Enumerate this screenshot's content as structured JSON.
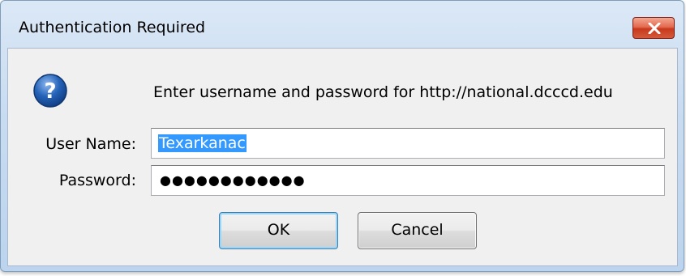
{
  "window": {
    "title": "Authentication Required",
    "close_icon": "close-icon"
  },
  "dialog": {
    "icon": "question-icon",
    "message": "Enter username and password for http://national.dcccd.edu",
    "username_label": "User Name:",
    "username_value": "Texarkanac",
    "password_label": "Password:",
    "password_value": "●●●●●●●●●●●●",
    "ok_label": "OK",
    "cancel_label": "Cancel"
  },
  "colors": {
    "selection_highlight": "#3399ff",
    "close_button": "#d45a3a",
    "help_icon": "#2463b8",
    "default_button_border": "#3c7fb1"
  }
}
